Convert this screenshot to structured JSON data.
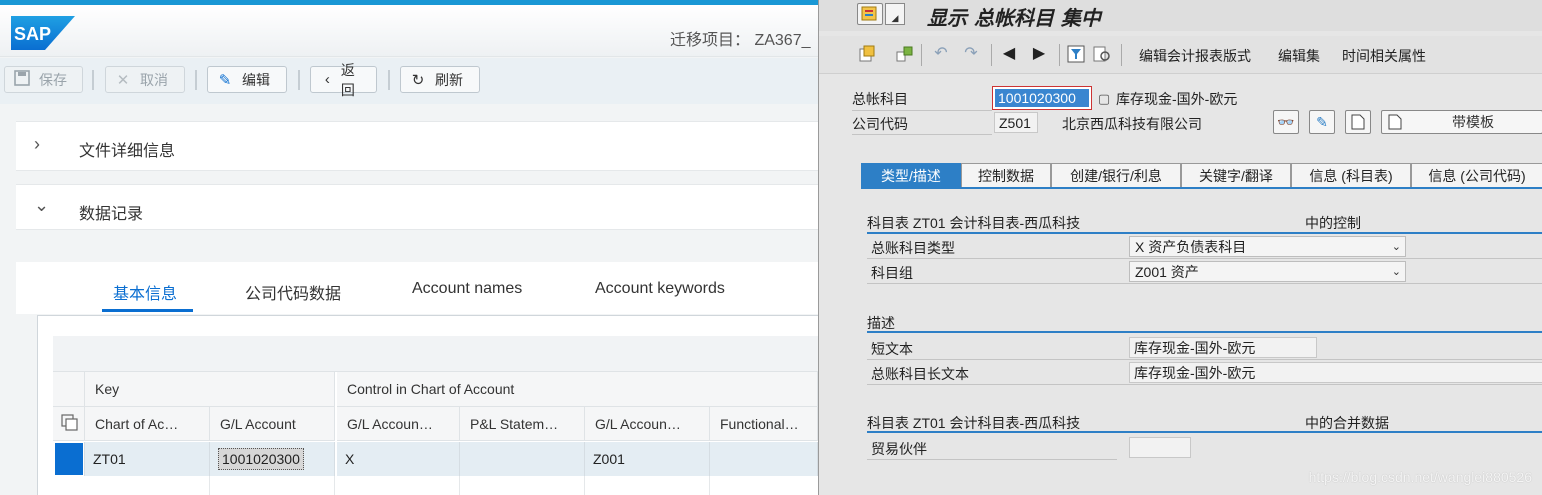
{
  "left": {
    "brand": "SAP",
    "migration_project": "迁移项目： ZA367_",
    "toolbar": {
      "save": "保存",
      "cancel": "取消",
      "edit": "编辑",
      "back": "返回",
      "refresh": "刷新"
    },
    "panels": {
      "file_details": "文件详细信息",
      "data_records": "数据记录"
    },
    "tabs": [
      "基本信息",
      "公司代码数据",
      "Account names",
      "Account keywords"
    ],
    "table": {
      "groups": [
        "Key",
        "Control in Chart of Account"
      ],
      "columns": [
        "Chart of Ac…",
        "G/L Account",
        "G/L Accoun…",
        "P&L Statem…",
        "G/L Accoun…",
        "Functional…"
      ],
      "rows": [
        [
          "ZT01",
          "1001020300",
          "X",
          "",
          "Z001",
          ""
        ]
      ]
    }
  },
  "right": {
    "window_title": "显示 总帐科目 集中",
    "app_toolbar": {
      "edit_report_format": "编辑会计报表版式",
      "edit_set": "编辑集",
      "time_dependent": "时间相关属性"
    },
    "header": {
      "gl_account_label": "总帐科目",
      "gl_account_value": "1001020300",
      "gl_account_desc": "库存现金-国外-欧元",
      "company_code_label": "公司代码",
      "company_code_value": "Z501",
      "company_name": "北京西瓜科技有限公司",
      "template_button": "带模板"
    },
    "tabs": [
      "类型/描述",
      "控制数据",
      "创建/银行/利息",
      "关键字/翻译",
      "信息 (科目表)",
      "信息 (公司代码)"
    ],
    "section1": {
      "title": "科目表 ZT01 会计科目表-西瓜科技",
      "title_right": "中的控制",
      "account_type_label": "总账科目类型",
      "account_type_value": "X 资产负债表科目",
      "account_group_label": "科目组",
      "account_group_value": "Z001 资产"
    },
    "section2": {
      "title": "描述",
      "short_text_label": "短文本",
      "short_text_value": "库存现金-国外-欧元",
      "long_text_label": "总账科目长文本",
      "long_text_value": "库存现金-国外-欧元"
    },
    "section3": {
      "title": "科目表 ZT01 会计科目表-西瓜科技",
      "title_right": "中的合并数据",
      "trading_partner_label": "贸易伙伴",
      "trading_partner_value": ""
    },
    "watermark": "https://blog.csdn.net/wanglei880526"
  }
}
